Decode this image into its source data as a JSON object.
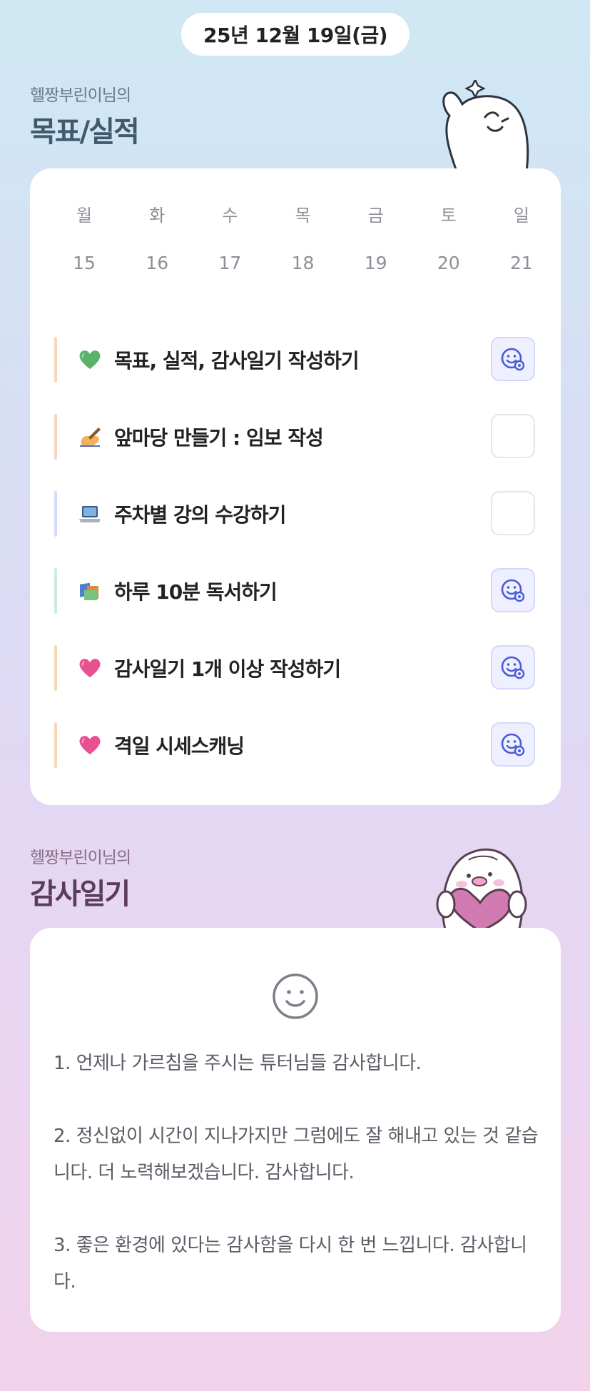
{
  "header": {
    "date": "25년 12월 19일(금)"
  },
  "goals_section": {
    "subtitle": "헬짱부린이님의",
    "title": "목표/실적"
  },
  "calendar": {
    "weekdays": [
      "월",
      "화",
      "수",
      "목",
      "금",
      "토",
      "일"
    ],
    "days": [
      "15",
      "16",
      "17",
      "18",
      "19",
      "20",
      "21"
    ]
  },
  "goals": [
    {
      "emoji_icon": "green-heart-icon",
      "text": "목표, 실적, 감사일기 작성하기",
      "bar_color": "#f6d9b7",
      "completed": true
    },
    {
      "emoji_icon": "writing-hand-icon",
      "text": "앞마당 만들기 : 임보 작성",
      "bar_color": "#f5d5c4",
      "completed": false
    },
    {
      "emoji_icon": "laptop-icon",
      "text": "주차별 강의 수강하기",
      "bar_color": "#d6dcf5",
      "completed": false
    },
    {
      "emoji_icon": "books-icon",
      "text": "하루 10분 독서하기",
      "bar_color": "#cfe9dc",
      "completed": true
    },
    {
      "emoji_icon": "pink-heart-icon",
      "text": "감사일기 1개 이상 작성하기",
      "bar_color": "#f6d9b7",
      "completed": true
    },
    {
      "emoji_icon": "pink-heart-icon",
      "text": "격일 시세스캐닝",
      "bar_color": "#f6d9b7",
      "completed": true
    }
  ],
  "diary_section": {
    "subtitle": "헬짱부린이님의",
    "title": "감사일기"
  },
  "diary": {
    "mood_icon": "smile-face-icon",
    "entries": [
      "1. 언제나 가르침을 주시는 튜터님들 감사합니다.",
      "2. 정신없이 시간이 지나가지만 그럼에도 잘 해내고 있는 것 같습니다. 더 노력해보겠습니다. 감사합니다.",
      "3. 좋은 환경에 있다는 감사함을 다시 한 번 느낍니다. 감사합니다."
    ]
  },
  "colors": {
    "check_done_bg": "#eef0ff",
    "check_done_icon": "#4a5bd8",
    "goals_title": "#3e5a6c",
    "diary_title": "#5c3c5a"
  }
}
